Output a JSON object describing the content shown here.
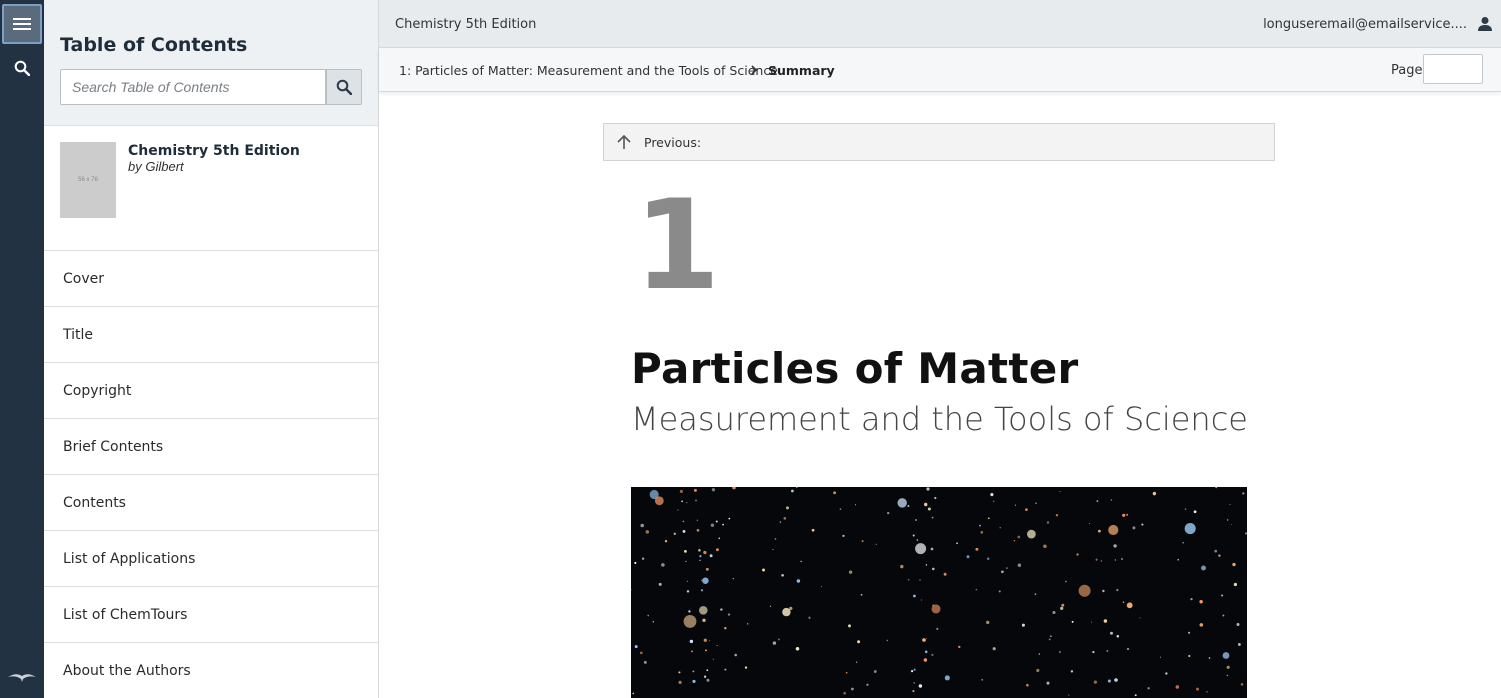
{
  "sidebar": {
    "heading": "Table of Contents",
    "search_placeholder": "Search Table of Contents",
    "book": {
      "title": "Chemistry 5th Edition",
      "author": "by Gilbert",
      "cover_placeholder": "56 x 76"
    },
    "items": [
      {
        "label": "Cover"
      },
      {
        "label": "Title"
      },
      {
        "label": "Copyright"
      },
      {
        "label": "Brief Contents"
      },
      {
        "label": "Contents"
      },
      {
        "label": "List of Applications"
      },
      {
        "label": "List of ChemTours"
      },
      {
        "label": "About the Authors"
      }
    ]
  },
  "topbar": {
    "book_name": "Chemistry 5th Edition",
    "user_email": "longuseremail@emailservice....",
    "user_icon": "user-icon"
  },
  "breadcrumb": {
    "chapter": "1: Particles of Matter: Measurement and the Tools of Science",
    "current": "Summary"
  },
  "page_jump": {
    "label": "Page",
    "value": ""
  },
  "content": {
    "previous_label": "Previous:",
    "chapter_number": "1",
    "chapter_title": "Particles of Matter",
    "chapter_subtitle": "Measurement and the Tools of Science"
  },
  "colors": {
    "rail_bg": "#233242",
    "annotation_arrow": "#e8391f",
    "chapter_number": "#8a8a8a"
  }
}
